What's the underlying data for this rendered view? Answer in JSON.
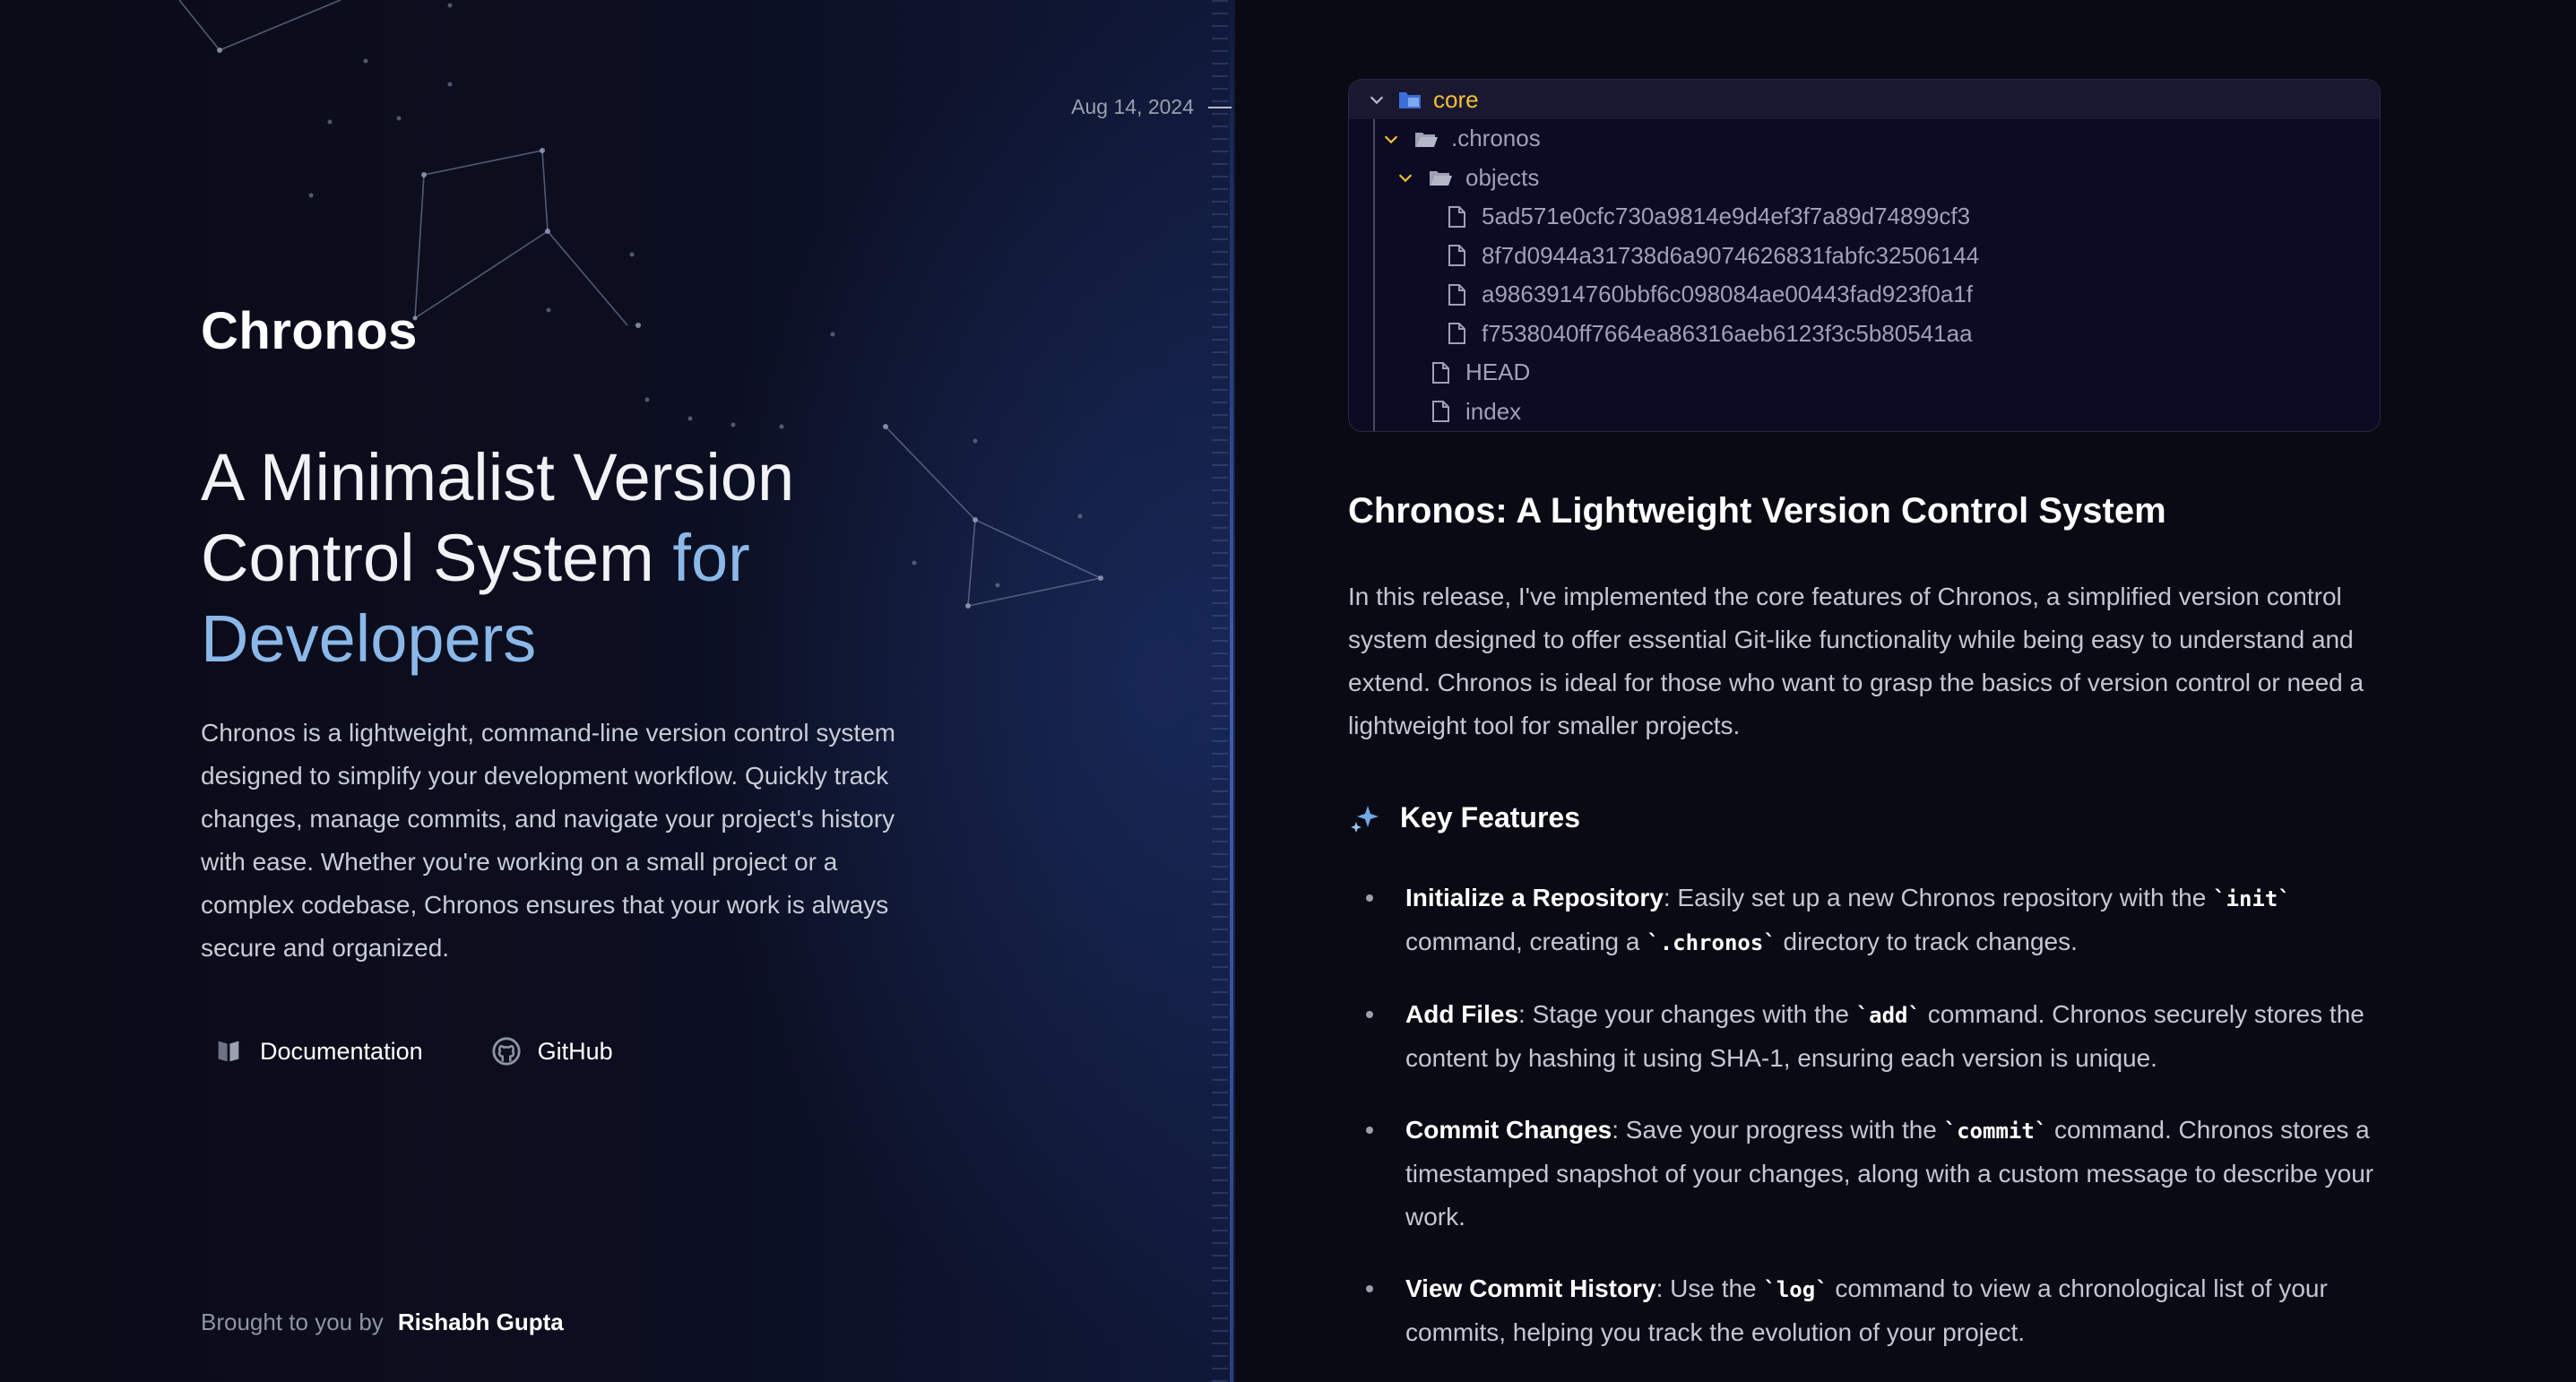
{
  "hero": {
    "date": "Aug 14, 2024",
    "brand": "Chronos",
    "headline_main": "A Minimalist Version Control System",
    "headline_accent": "for Developers",
    "description": "Chronos is a lightweight, command-line version control system designed to simplify your development workflow. Quickly track changes, manage commits, and navigate your project's history with ease. Whether you're working on a small project or a complex codebase, Chronos ensures that your work is always secure and organized.",
    "links": [
      {
        "label": "Documentation",
        "icon": "book-icon"
      },
      {
        "label": "GitHub",
        "icon": "github-icon"
      }
    ],
    "credit_prefix": "Brought to you by",
    "credit_author": "Rishabh Gupta"
  },
  "file_tree": {
    "root": "core",
    "items": [
      {
        "name": ".chronos",
        "type": "folder"
      },
      {
        "name": "objects",
        "type": "folder"
      },
      {
        "name": "5ad571e0cfc730a9814e9d4ef3f7a89d74899cf3",
        "type": "file"
      },
      {
        "name": "8f7d0944a31738d6a9074626831fabfc32506144",
        "type": "file"
      },
      {
        "name": "a9863914760bbf6c098084ae00443fad923f0a1f",
        "type": "file"
      },
      {
        "name": "f7538040ff7664ea86316aeb6123f3c5b80541aa",
        "type": "file"
      },
      {
        "name": "HEAD",
        "type": "file"
      },
      {
        "name": "index",
        "type": "file"
      }
    ]
  },
  "article": {
    "title": "Chronos: A Lightweight Version Control System",
    "body": "In this release, I've implemented the core features of Chronos, a simplified version control system designed to offer essential Git-like functionality while being easy to understand and extend. Chronos is ideal for those who want to grasp the basics of version control or need a lightweight tool for smaller projects.",
    "features_heading": "Key Features",
    "features": [
      {
        "term": "Initialize a Repository",
        "p1": ": Easily set up a new Chronos repository with the ",
        "code1": "`init`",
        "p2": " command, creating a ",
        "code2": "`.chronos`",
        "p3": " directory to track changes."
      },
      {
        "term": "Add Files",
        "p1": ": Stage your changes with the ",
        "code1": "`add`",
        "p2": " command. Chronos securely stores the content by hashing it using SHA-1, ensuring each version is unique.",
        "code2": "",
        "p3": ""
      },
      {
        "term": "Commit Changes",
        "p1": ": Save your progress with the ",
        "code1": "`commit`",
        "p2": " command. Chronos stores a timestamped snapshot of your changes, along with a custom message to describe your work.",
        "code2": "",
        "p3": ""
      },
      {
        "term": "View Commit History",
        "p1": ": Use the ",
        "code1": "`log`",
        "p2": " command to view a chronological list of your commits, helping you track the evolution of your project.",
        "code2": "",
        "p3": ""
      }
    ]
  },
  "colors": {
    "accent": "#8ab8e8",
    "root_folder": "#f2c037",
    "background": "#0b0b17"
  }
}
